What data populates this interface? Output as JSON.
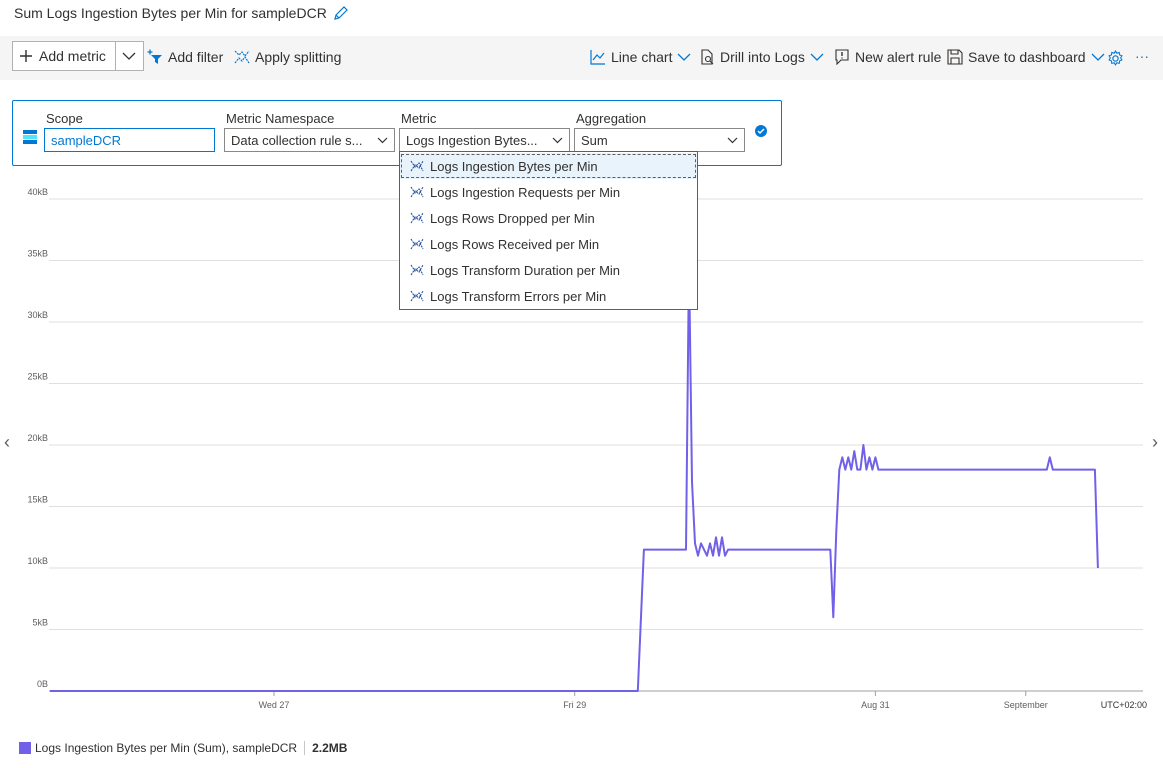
{
  "title": "Sum Logs Ingestion Bytes per Min for sampleDCR",
  "toolbar": {
    "add_metric": "Add metric",
    "add_filter": "Add filter",
    "apply_splitting": "Apply splitting",
    "line_chart": "Line chart",
    "drill_logs": "Drill into Logs",
    "new_alert": "New alert rule",
    "save_dashboard": "Save to dashboard",
    "more": "···"
  },
  "metric_row": {
    "scope_label": "Scope",
    "scope_value": "sampleDCR",
    "namespace_label": "Metric Namespace",
    "namespace_value": "Data collection rule s...",
    "metric_label": "Metric",
    "metric_value": "Logs Ingestion Bytes...",
    "aggregation_label": "Aggregation",
    "aggregation_value": "Sum"
  },
  "metric_options": [
    "Logs Ingestion Bytes per Min",
    "Logs Ingestion Requests per Min",
    "Logs Rows Dropped per Min",
    "Logs Rows Received per Min",
    "Logs Transform Duration per Min",
    "Logs Transform Errors per Min"
  ],
  "legend": {
    "label": "Logs Ingestion Bytes per Min (Sum), sampleDCR",
    "value": "2.2MB"
  },
  "colors": {
    "series": "#7160e8",
    "accent": "#0078d4"
  },
  "chart_data": {
    "type": "line",
    "y_ticks": [
      "0B",
      "5kB",
      "10kB",
      "15kB",
      "20kB",
      "25kB",
      "30kB",
      "35kB",
      "40kB"
    ],
    "ylim": [
      0,
      40
    ],
    "y_unit": "kB",
    "x_ticks": [
      {
        "label": "Wed 27",
        "x": 1
      },
      {
        "label": "Fri 29",
        "x": 3
      },
      {
        "label": "Aug 31",
        "x": 5
      },
      {
        "label": "September",
        "x": 6
      }
    ],
    "xlim": [
      -0.49,
      6.78
    ],
    "timezone": "UTC+02:00",
    "grid": true,
    "series": [
      {
        "name": "Logs Ingestion Bytes per Min (Sum), sampleDCR",
        "points": [
          [
            -0.49,
            0
          ],
          [
            3.42,
            0
          ],
          [
            3.46,
            11.5
          ],
          [
            3.74,
            11.5
          ],
          [
            3.76,
            35
          ],
          [
            3.78,
            17
          ],
          [
            3.8,
            12
          ],
          [
            3.82,
            11
          ],
          [
            3.84,
            12
          ],
          [
            3.86,
            11.5
          ],
          [
            3.88,
            11
          ],
          [
            3.9,
            12
          ],
          [
            3.92,
            11
          ],
          [
            3.94,
            12.5
          ],
          [
            3.96,
            11
          ],
          [
            3.98,
            12.5
          ],
          [
            4.0,
            11
          ],
          [
            4.02,
            11.5
          ],
          [
            4.7,
            11.5
          ],
          [
            4.72,
            6
          ],
          [
            4.74,
            13
          ],
          [
            4.76,
            18
          ],
          [
            4.78,
            19
          ],
          [
            4.8,
            18
          ],
          [
            4.82,
            19
          ],
          [
            4.84,
            18
          ],
          [
            4.86,
            19.5
          ],
          [
            4.88,
            18
          ],
          [
            4.9,
            18
          ],
          [
            4.92,
            20
          ],
          [
            4.94,
            18
          ],
          [
            4.96,
            19
          ],
          [
            4.98,
            18
          ],
          [
            5.0,
            19
          ],
          [
            5.02,
            18
          ],
          [
            6.14,
            18
          ],
          [
            6.16,
            19
          ],
          [
            6.18,
            18
          ],
          [
            6.46,
            18
          ],
          [
            6.48,
            10
          ]
        ]
      }
    ]
  }
}
